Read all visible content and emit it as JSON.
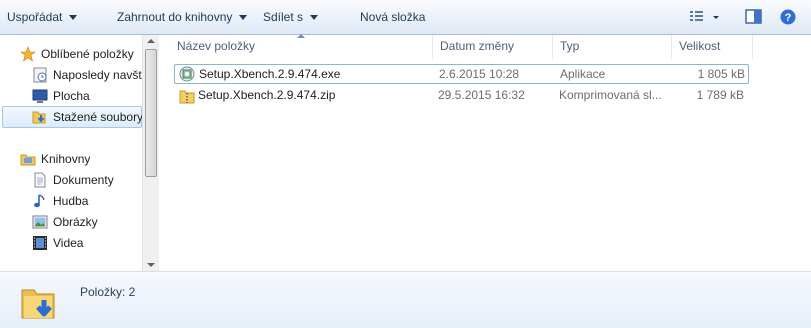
{
  "toolbar": {
    "organize": "Uspořádat",
    "include_library": "Zahrnout do knihovny",
    "share": "Sdílet s",
    "new_folder": "Nová složka",
    "icons": [
      "view-options-icon",
      "preview-pane-icon",
      "help-icon"
    ]
  },
  "nav": {
    "favorites": {
      "label": "Oblíbené položky",
      "items": [
        {
          "label": "Naposledy navštívené",
          "icon": "recent-places-icon"
        },
        {
          "label": "Plocha",
          "icon": "desktop-icon"
        },
        {
          "label": "Stažené soubory",
          "icon": "downloads-icon"
        }
      ]
    },
    "libraries": {
      "label": "Knihovny",
      "items": [
        {
          "label": "Dokumenty",
          "icon": "documents-icon"
        },
        {
          "label": "Hudba",
          "icon": "music-icon"
        },
        {
          "label": "Obrázky",
          "icon": "pictures-icon"
        },
        {
          "label": "Videa",
          "icon": "videos-icon"
        }
      ]
    }
  },
  "columns": {
    "name": "Název položky",
    "date": "Datum změny",
    "type": "Typ",
    "size": "Velikost"
  },
  "files": [
    {
      "name": "Setup.Xbench.2.9.474.exe",
      "date": "2.6.2015 10:28",
      "type": "Aplikace",
      "size": "1 805 kB",
      "icon": "installer-icon"
    },
    {
      "name": "Setup.Xbench.2.9.474.zip",
      "date": "29.5.2015 16:32",
      "type": "Komprimovaná sl...",
      "size": "1 789 kB",
      "icon": "zip-folder-icon"
    }
  ],
  "status": {
    "items_text": "Položky: 2"
  },
  "colors": {
    "toolbar_text": "#1e395b",
    "selection_border": "#a6c7ea",
    "header_text": "#4c607a"
  }
}
